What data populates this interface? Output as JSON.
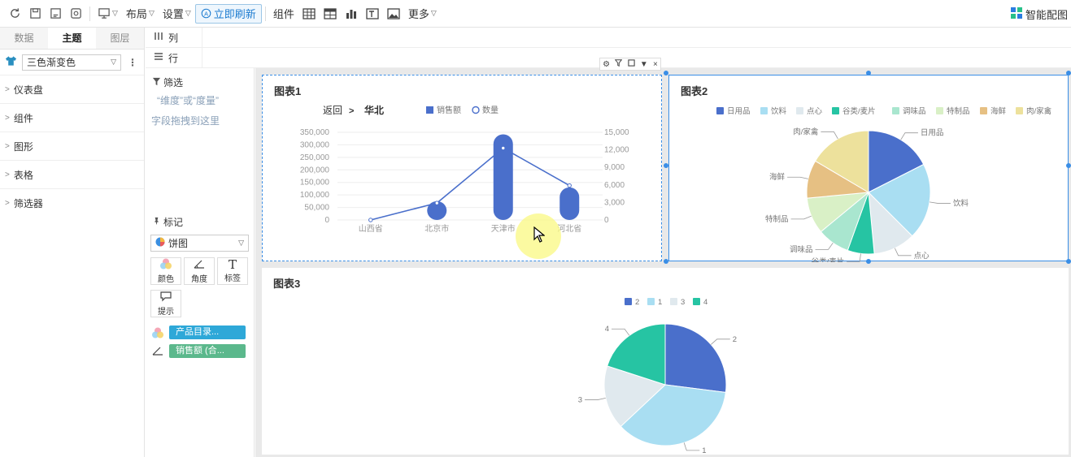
{
  "toolbar": {
    "layout_label": "布局",
    "settings_label": "设置",
    "refresh_label": "立即刷新",
    "components_label": "组件",
    "more_label": "更多",
    "smart_label": "智能配图"
  },
  "left_panel": {
    "tabs": [
      "数据",
      "主题",
      "图层"
    ],
    "active_tab": "主题",
    "theme_value": "三色渐变色",
    "sections": [
      "仪表盘",
      "组件",
      "图形",
      "表格",
      "筛选器"
    ]
  },
  "shelves": {
    "columns_label": "列",
    "rows_label": "行"
  },
  "filter": {
    "title": "筛选",
    "hint_line1": "“维度”或“度量”",
    "hint_line2": "字段拖拽到这里"
  },
  "marks": {
    "title": "标记",
    "type_value": "饼图",
    "buttons": [
      "颜色",
      "角度",
      "标签",
      "提示"
    ],
    "fields": [
      {
        "label": "产品目录...",
        "color": "#2ea8d8"
      },
      {
        "label": "销售额 (合...",
        "color": "#5bb88c"
      }
    ]
  },
  "chart1": {
    "title": "图表1",
    "back_label": "返回",
    "drill_label": "华北",
    "chart_data": {
      "type": "bar",
      "categories": [
        "山西省",
        "北京市",
        "天津市",
        "河北省"
      ],
      "series": [
        {
          "name": "销售额",
          "values": [
            0,
            75000,
            342000,
            130000
          ]
        },
        {
          "name": "数量",
          "values": [
            0,
            2900,
            12300,
            5900
          ]
        }
      ],
      "y_ticks": [
        "0",
        "50,000",
        "100,000",
        "150,000",
        "200,000",
        "250,000",
        "300,000",
        "350,000"
      ],
      "y2_ticks": [
        "0",
        "3,000",
        "6,000",
        "9,000",
        "12,000",
        "15,000"
      ],
      "ylim": [
        0,
        350000
      ],
      "y2lim": [
        0,
        15000
      ]
    }
  },
  "chart2": {
    "title": "图表2",
    "chart_data": {
      "type": "pie",
      "categories": [
        "日用品",
        "饮料",
        "点心",
        "谷类/麦片",
        "调味品",
        "特制品",
        "海鲜",
        "肉/家禽"
      ],
      "values": [
        17.5,
        20,
        11,
        7,
        8.5,
        9.5,
        10,
        16.5
      ],
      "colors": [
        "#4a6fcb",
        "#a9def2",
        "#e0e9ee",
        "#26c4a3",
        "#a9e6cf",
        "#d9f0c6",
        "#e6c083",
        "#ede19c"
      ]
    }
  },
  "chart3": {
    "title": "图表3",
    "chart_data": {
      "type": "pie",
      "categories": [
        "2",
        "1",
        "3",
        "4"
      ],
      "values": [
        27,
        36,
        17,
        20
      ],
      "colors": [
        "#4a6fcb",
        "#a9def2",
        "#e0e9ee",
        "#26c4a3"
      ]
    }
  }
}
